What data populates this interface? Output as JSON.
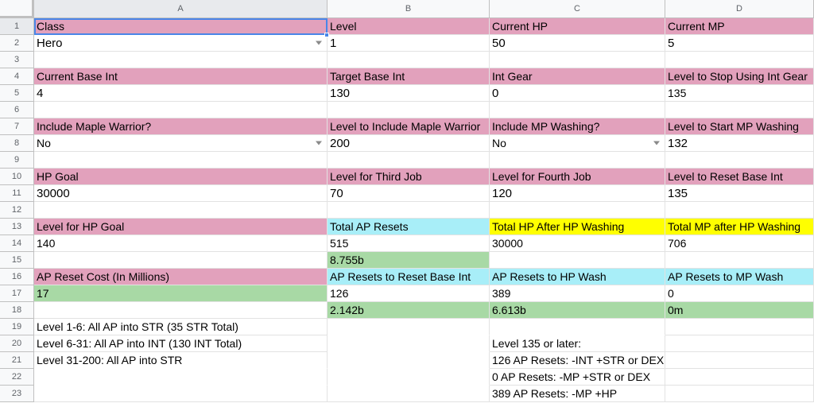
{
  "columns": [
    "A",
    "B",
    "C",
    "D"
  ],
  "rows": [
    "1",
    "2",
    "3",
    "4",
    "5",
    "6",
    "7",
    "8",
    "9",
    "10",
    "11",
    "12",
    "13",
    "14",
    "15",
    "16",
    "17",
    "18",
    "19",
    "20",
    "21",
    "22",
    "23"
  ],
  "r1": {
    "a": "Class",
    "b": "Level",
    "c": "Current HP",
    "d": "Current MP"
  },
  "r2": {
    "a": "Hero",
    "b": "1",
    "c": "50",
    "d": "5"
  },
  "r4": {
    "a": "Current Base Int",
    "b": "Target Base Int",
    "c": "Int Gear",
    "d": "Level to Stop Using Int Gear"
  },
  "r5": {
    "a": "4",
    "b": "130",
    "c": "0",
    "d": "135"
  },
  "r7": {
    "a": "Include Maple Warrior?",
    "b": "Level to Include Maple Warrior",
    "c": "Include MP Washing?",
    "d": "Level to Start MP Washing"
  },
  "r8": {
    "a": "No",
    "b": "200",
    "c": "No",
    "d": "132"
  },
  "r10": {
    "a": "HP Goal",
    "b": "Level for Third Job",
    "c": "Level for Fourth Job",
    "d": "Level to Reset Base Int"
  },
  "r11": {
    "a": "30000",
    "b": "70",
    "c": "120",
    "d": "135"
  },
  "r13": {
    "a": "Level for HP Goal",
    "b": "Total AP Resets",
    "c": "Total HP After HP Washing",
    "d": "Total MP after HP Washing"
  },
  "r14": {
    "a": "140",
    "b": "515",
    "c": "30000",
    "d": "706"
  },
  "r15": {
    "b": "8.755b"
  },
  "r16": {
    "a": "AP Reset Cost (In Millions)",
    "b": "AP Resets to Reset Base Int",
    "c": "AP Resets to HP Wash",
    "d": "AP Resets to MP Wash"
  },
  "r17": {
    "a": "17",
    "b": "126",
    "c": "389",
    "d": "0"
  },
  "r18": {
    "b": "2.142b",
    "c": "6.613b",
    "d": "0m"
  },
  "r19": {
    "a": "Level 1-6: All AP into STR (35 STR Total)"
  },
  "r20": {
    "a": "Level 6-31: All AP into INT (130 INT Total)",
    "c": "Level 135 or later:"
  },
  "r21": {
    "a": "Level 31-200: All AP into STR",
    "c": "126 AP Resets: -INT +STR or DEX"
  },
  "r22": {
    "c": "0 AP Resets: -MP +STR or DEX"
  },
  "r23": {
    "c": "389 AP Resets: -MP +HP"
  },
  "colors": {
    "label": "#e2a1bc",
    "calc": "#a8eef8",
    "highlight": "#ffff00",
    "cost": "#a8d9a5",
    "selection": "#4a86e8"
  }
}
